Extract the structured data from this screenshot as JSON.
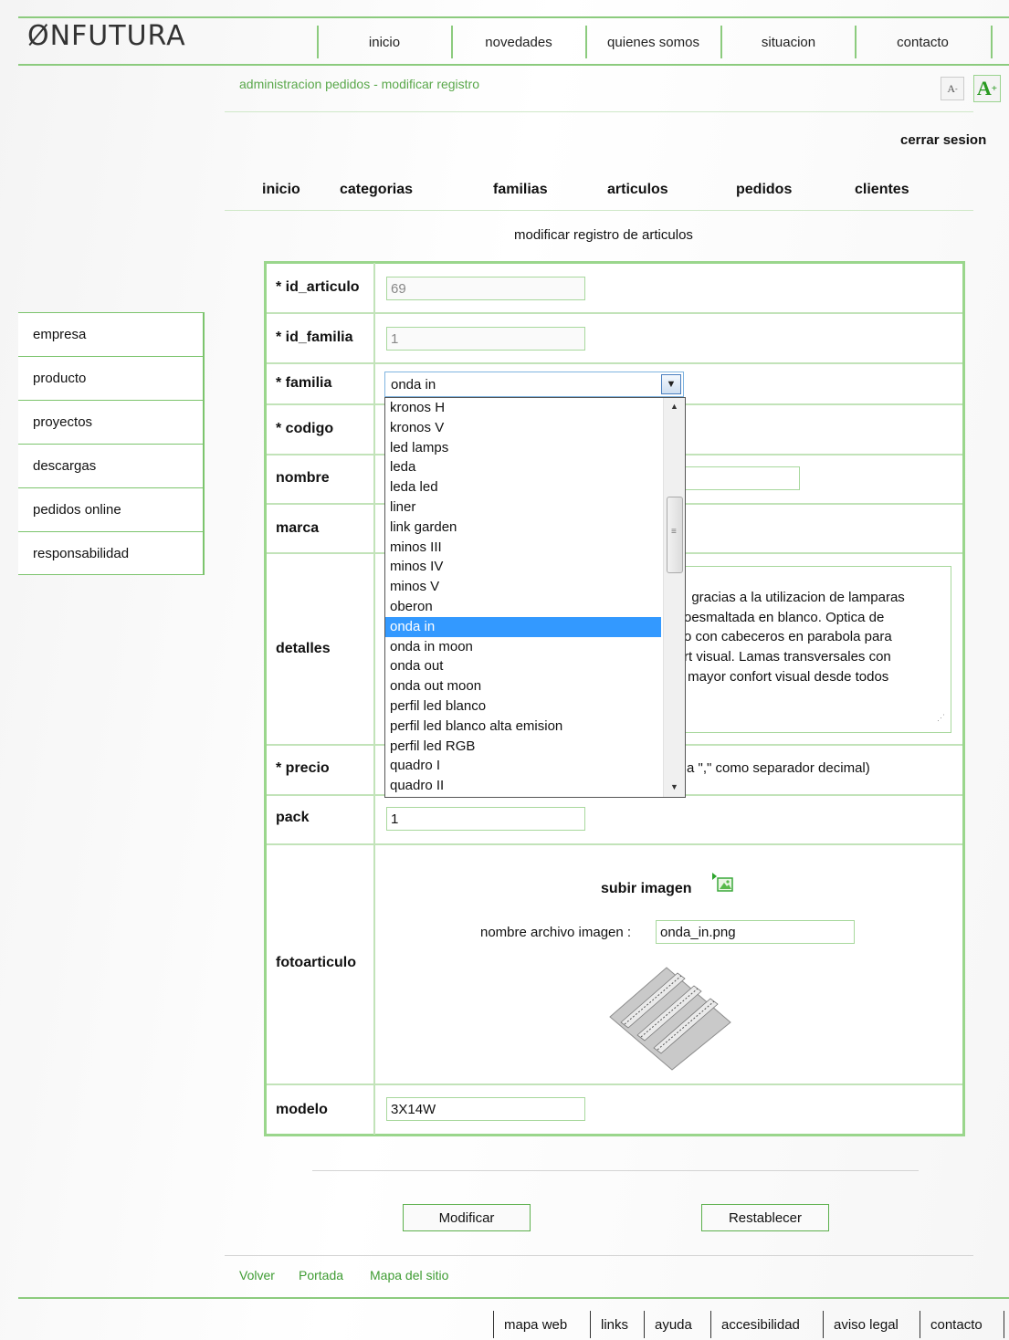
{
  "header": {
    "logo": "ØNFUTURA",
    "nav": [
      "inicio",
      "novedades",
      "quienes somos",
      "situacion",
      "contacto"
    ],
    "breadcrumb": "administracion pedidos - modificar registro",
    "font_small": "A",
    "font_large": "A",
    "logout": "cerrar sesion"
  },
  "admin_nav": [
    "inicio",
    "categorias",
    "familias",
    "articulos",
    "pedidos",
    "clientes"
  ],
  "form": {
    "title": "modificar registro de articulos",
    "fields": {
      "id_articulo": {
        "label": "* id_articulo",
        "value": "69"
      },
      "id_familia": {
        "label": "* id_familia",
        "value": "1"
      },
      "familia": {
        "label": "* familia",
        "value": "onda in"
      },
      "codigo": {
        "label": "* codigo"
      },
      "nombre": {
        "label": "nombre"
      },
      "marca": {
        "label": "marca"
      },
      "detalles": {
        "label": "detalles",
        "visible_text": "gracias a la utilizacion de lamparas\noesmaltada en blanco. Optica de\no con cabeceros en parabola para\nrt visual. Lamas transversales con\n mayor confort visual desde todos"
      },
      "precio": {
        "label": "* precio",
        "note": "a \",\" como separador decimal)"
      },
      "pack": {
        "label": "pack",
        "value": "1"
      },
      "fotoarticulo": {
        "label": "fotoarticulo",
        "upload_label": "subir imagen",
        "filename_label": "nombre archivo imagen :",
        "filename_value": "onda_in.png"
      },
      "modelo": {
        "label": "modelo",
        "value": "3X14W"
      }
    },
    "dropdown_options": [
      "kronos H",
      "kronos V",
      "led lamps",
      "leda",
      "leda led",
      "liner",
      "link garden",
      "minos III",
      "minos IV",
      "minos V",
      "oberon",
      "onda in",
      "onda in moon",
      "onda out",
      "onda out moon",
      "perfil led blanco",
      "perfil led blanco alta emision",
      "perfil led RGB",
      "quadro I",
      "quadro II"
    ],
    "selected_option": "onda in",
    "buttons": {
      "submit": "Modificar",
      "reset": "Restablecer"
    }
  },
  "sidebar": [
    "empresa",
    "producto",
    "proyectos",
    "descargas",
    "pedidos online",
    "responsabilidad"
  ],
  "bottom_links": [
    "Volver",
    "Portada",
    "Mapa del sitio"
  ],
  "footer": [
    "mapa web",
    "links",
    "ayuda",
    "accesibilidad",
    "aviso legal",
    "contacto"
  ],
  "colors": {
    "accent_green": "#8ccb7e",
    "link_green": "#3f9c33",
    "selection_blue": "#3399ff"
  }
}
